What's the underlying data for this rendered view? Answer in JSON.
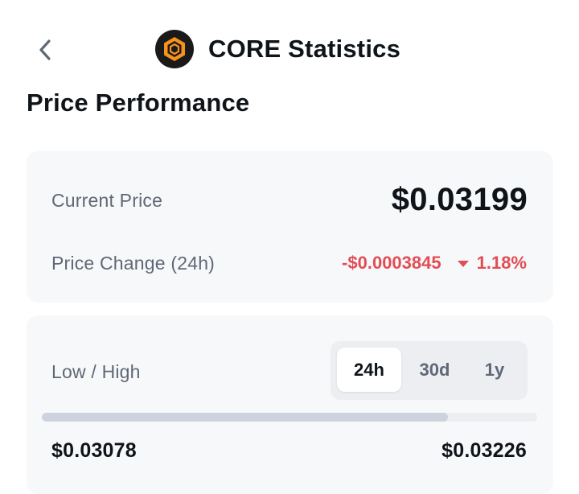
{
  "header": {
    "back_icon": "chevron-left-icon",
    "logo_icon": "core-hexagon-logo",
    "title": "CORE Statistics"
  },
  "section": {
    "title": "Price Performance"
  },
  "price_card": {
    "current_label": "Current Price",
    "current_value": "$0.03199",
    "change_label": "Price Change (24h)",
    "change_abs": "-$0.0003845",
    "change_pct": "1.18%",
    "change_direction_icon": "triangle-down-icon",
    "change_color": "#e24d54"
  },
  "range_card": {
    "label": "Low / High",
    "tabs": [
      {
        "label": "24h",
        "active": true
      },
      {
        "label": "30d",
        "active": false
      },
      {
        "label": "1y",
        "active": false
      }
    ],
    "low": "$0.03078",
    "high": "$0.03226",
    "progress_fraction": 0.82
  },
  "colors": {
    "brand_orange": "#f7931a",
    "text_primary": "#0f1419",
    "text_secondary": "#5f6876",
    "negative": "#e24d54",
    "card_bg": "#f7f8fa"
  }
}
